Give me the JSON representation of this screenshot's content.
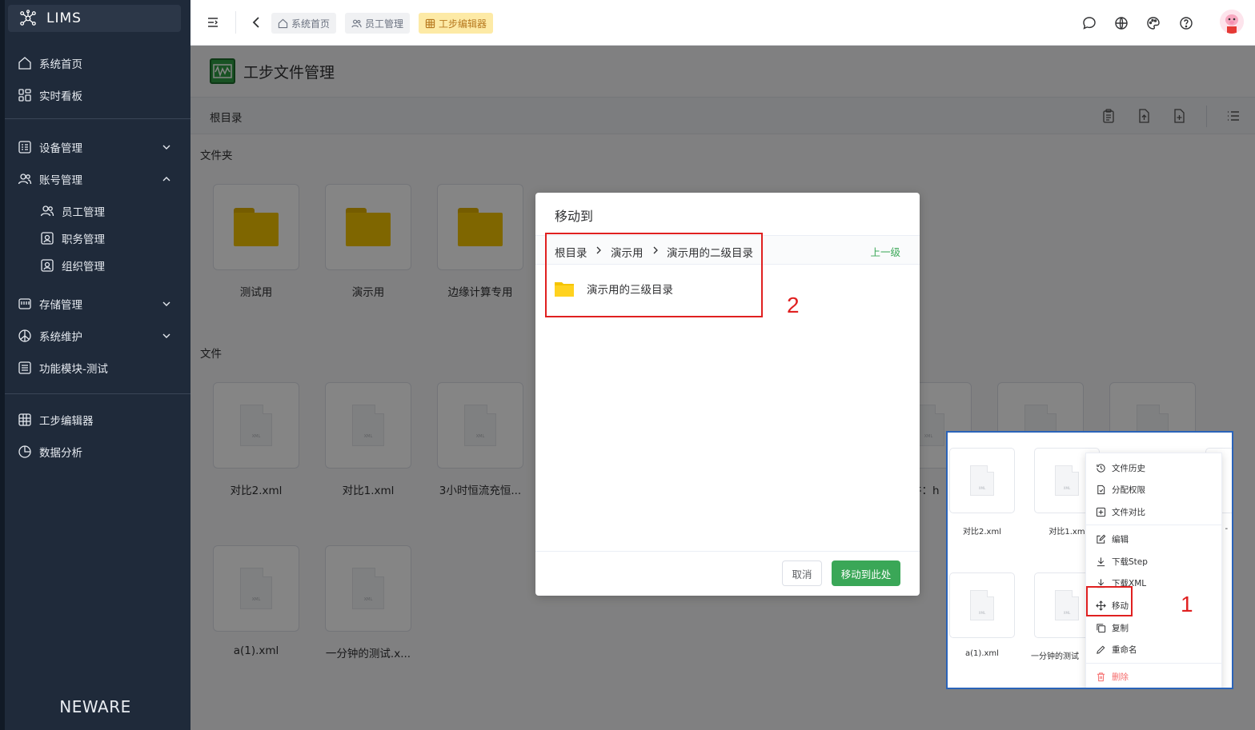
{
  "app": {
    "name": "LIMS",
    "brand": "NEWARE"
  },
  "sidebar": {
    "items": [
      {
        "label": "系统首页",
        "icon": "home-icon"
      },
      {
        "label": "实时看板",
        "icon": "dashboard-icon"
      },
      {
        "label": "设备管理",
        "icon": "device-icon",
        "expandable": true
      },
      {
        "label": "账号管理",
        "icon": "users-icon",
        "expanded": true
      },
      {
        "label": "员工管理",
        "icon": "users-icon"
      },
      {
        "label": "职务管理",
        "icon": "id-card-icon"
      },
      {
        "label": "组织管理",
        "icon": "id-card-icon"
      },
      {
        "label": "存储管理",
        "icon": "storage-icon",
        "expandable": true
      },
      {
        "label": "系统维护",
        "icon": "maintenance-icon",
        "expandable": true
      },
      {
        "label": "功能模块-测试",
        "icon": "module-icon"
      },
      {
        "label": "工步编辑器",
        "icon": "grid-icon"
      },
      {
        "label": "数据分析",
        "icon": "pie-chart-icon"
      }
    ]
  },
  "header": {
    "tabs": [
      {
        "label": "系统首页",
        "icon": "home-icon"
      },
      {
        "label": "员工管理",
        "icon": "users-icon"
      },
      {
        "label": "工步编辑器",
        "icon": "grid-icon",
        "active": true
      }
    ]
  },
  "page": {
    "title": "工步文件管理",
    "breadcrumb": "根目录",
    "folders_label": "文件夹",
    "files_label": "文件",
    "folders": [
      "测试用",
      "演示用",
      "边缘计算专用"
    ],
    "files": [
      "对比2.xml",
      "对比1.xml",
      "3小时恒流充恒...",
      "a(1).xml",
      "一分钟的测试.x..."
    ],
    "partial_file_label": "件：h",
    "file_type": "XML"
  },
  "dialog": {
    "title": "移动到",
    "path": [
      "根目录",
      "演示用",
      "演示用的二级目录"
    ],
    "up_label": "上一级",
    "folder_item": "演示用的三级目录",
    "cancel_label": "取消",
    "confirm_label": "移动到此处"
  },
  "annotations": {
    "step1": "1",
    "step2": "2"
  },
  "inset": {
    "files": [
      "对比2.xml",
      "对比1.xm",
      "a(1).xml",
      "一分钟的测试"
    ],
    "partial": "1 -",
    "menu": [
      {
        "label": "文件历史",
        "icon": "history-icon"
      },
      {
        "label": "分配权限",
        "icon": "permission-icon"
      },
      {
        "label": "文件对比",
        "icon": "compare-icon"
      },
      {
        "label": "编辑",
        "icon": "edit-icon"
      },
      {
        "label": "下载Step",
        "icon": "download-icon"
      },
      {
        "label": "下载XML",
        "icon": "download-icon"
      },
      {
        "label": "移动",
        "icon": "move-icon"
      },
      {
        "label": "复制",
        "icon": "copy-icon"
      },
      {
        "label": "重命名",
        "icon": "rename-icon"
      },
      {
        "label": "删除",
        "icon": "delete-icon"
      }
    ]
  },
  "colors": {
    "sidebar_bg": "#1f2a3a",
    "accent_green": "#3aa757",
    "annotation_red": "#e02020",
    "folder_yellow": "#f3c300"
  }
}
